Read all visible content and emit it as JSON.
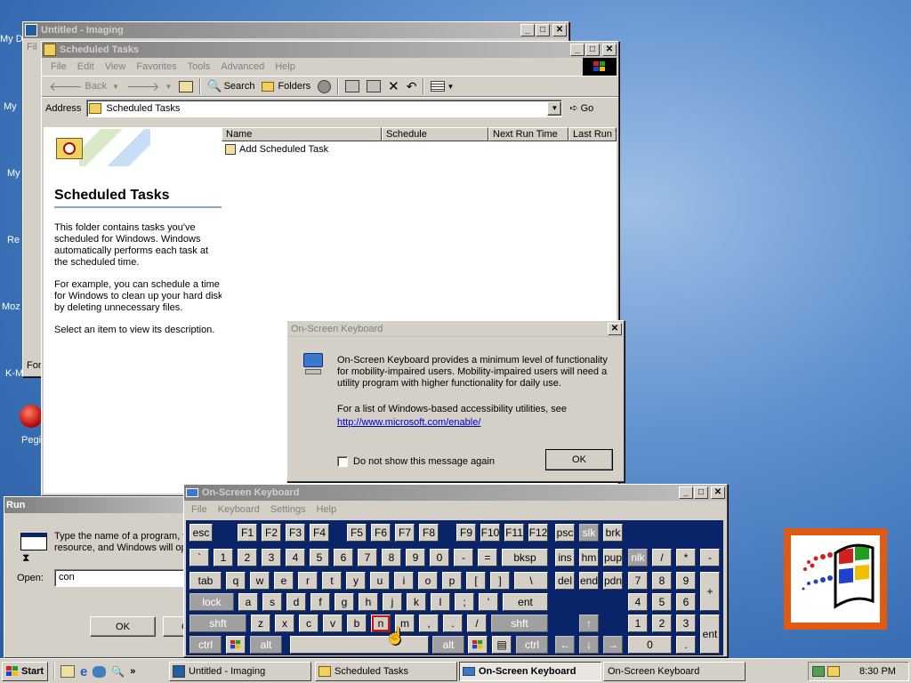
{
  "desktop": {
    "icons": [
      "My D",
      "My",
      "My",
      "Re",
      "Moz",
      "K-Mele",
      "Pegi"
    ]
  },
  "imaging": {
    "title": "Untitled - Imaging",
    "menu_first": "Fil",
    "status_first": "For"
  },
  "explorer": {
    "title": "Scheduled Tasks",
    "menu": [
      "File",
      "Edit",
      "View",
      "Favorites",
      "Tools",
      "Advanced",
      "Help"
    ],
    "toolbar": {
      "back": "Back",
      "search": "Search",
      "folders": "Folders"
    },
    "address_label": "Address",
    "address_value": "Scheduled Tasks",
    "go_label": "Go",
    "heading": "Scheduled Tasks",
    "desc1": "This folder contains tasks you've scheduled for Windows. Windows automatically performs each task at the scheduled time.",
    "desc2": "For example, you can schedule a time for Windows to clean up your hard disk by deleting unnecessary files.",
    "desc3": "Select an item to view its description.",
    "columns": [
      "Name",
      "Schedule",
      "Next Run Time",
      "Last Run T"
    ],
    "items": [
      "Add Scheduled Task"
    ]
  },
  "osk_dialog": {
    "title": "On-Screen Keyboard",
    "text1": "On-Screen Keyboard provides a minimum level of functionality for mobility-impaired users. Mobility-impaired users will need a utility program with higher functionality for daily use.",
    "text2": "For a list of Windows-based accessibility utilities, see",
    "link": "http://www.microsoft.com/enable/",
    "checkbox_label": "Do not show this message again",
    "ok": "OK"
  },
  "run": {
    "title": "Run",
    "text": "Type the name of a program, folder, document, or Internet resource, and Windows will open it for you.",
    "open_label": "Open:",
    "open_value": "con",
    "ok": "OK",
    "cancel": "C"
  },
  "osk": {
    "title": "On-Screen Keyboard",
    "menu": [
      "File",
      "Keyboard",
      "Settings",
      "Help"
    ]
  },
  "taskbar": {
    "start": "Start",
    "items": [
      "Untitled - Imaging",
      "Scheduled Tasks",
      "On-Screen Keyboard",
      "On-Screen Keyboard"
    ],
    "time": "8:30 PM"
  },
  "colors": {
    "title_active": "#0a246a",
    "title_inactive": "#808080",
    "face": "#d4d0c8",
    "kb_bg": "#0a246a"
  }
}
